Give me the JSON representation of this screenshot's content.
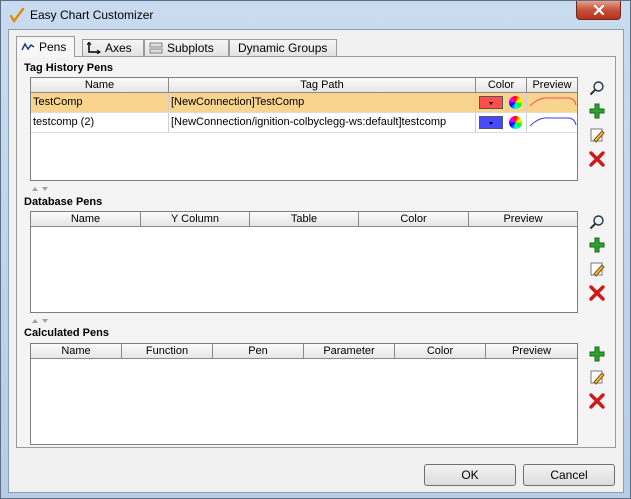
{
  "window": {
    "title": "Easy Chart Customizer"
  },
  "tabs": [
    {
      "label": "Pens",
      "active": true
    },
    {
      "label": "Axes"
    },
    {
      "label": "Subplots"
    },
    {
      "label": "Dynamic Groups"
    }
  ],
  "tag_history": {
    "title": "Tag History Pens",
    "columns": [
      "Name",
      "Tag Path",
      "Color",
      "Preview"
    ],
    "rows": [
      {
        "name": "TestComp",
        "tag_path": "[NewConnection]TestComp",
        "color": "#ff4444",
        "selected": true
      },
      {
        "name": "testcomp (2)",
        "tag_path": "[NewConnection/ignition-colbyclegg-ws:default]testcomp",
        "color": "#4444ff",
        "selected": false
      }
    ]
  },
  "database": {
    "title": "Database Pens",
    "columns": [
      "Name",
      "Y Column",
      "Table",
      "Color",
      "Preview"
    ]
  },
  "calculated": {
    "title": "Calculated Pens",
    "columns": [
      "Name",
      "Function",
      "Pen",
      "Parameter",
      "Color",
      "Preview"
    ]
  },
  "buttons": {
    "ok": "OK",
    "cancel": "Cancel"
  },
  "icons": {
    "search": "search-icon",
    "add": "add-icon",
    "edit": "edit-icon",
    "delete": "delete-icon"
  }
}
